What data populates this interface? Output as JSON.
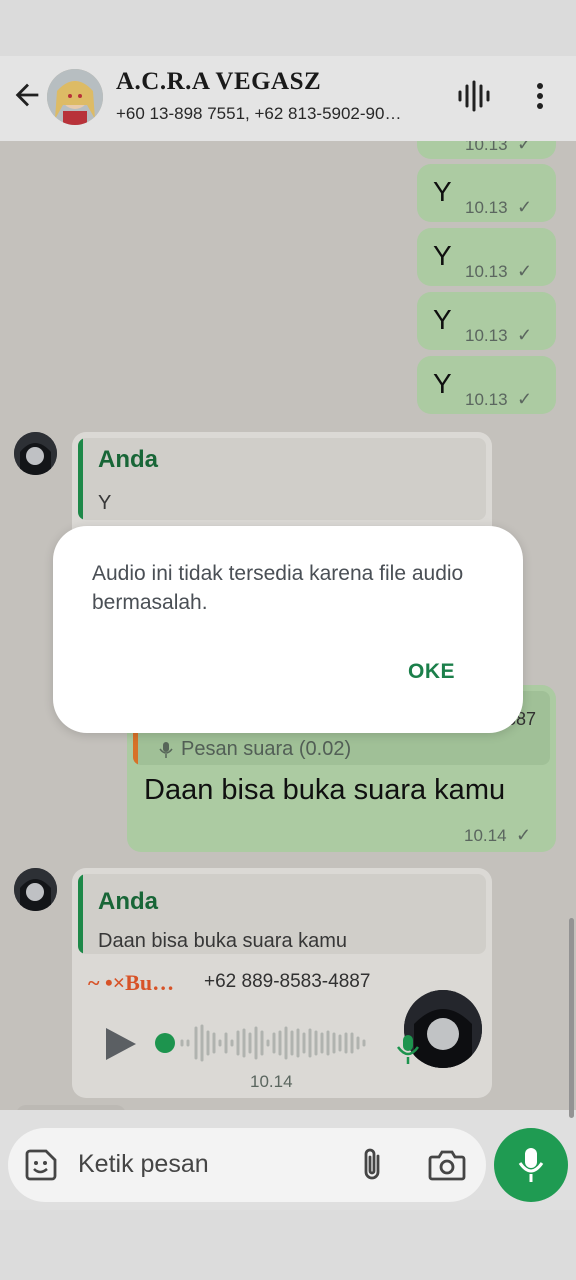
{
  "header": {
    "contact_name": "A.C.R.A VEGASZ",
    "participants": "+60 13-898 7551, +62 813-5902-90…",
    "back_icon": "arrow-left-icon",
    "call_icon": "audio-wave-icon",
    "menu_icon": "more-vertical-icon"
  },
  "messages": {
    "top_partial": {
      "time": "10.13"
    },
    "y1": {
      "text": "Y",
      "time": "10.13"
    },
    "y2": {
      "text": "Y",
      "time": "10.13"
    },
    "y3": {
      "text": "Y",
      "time": "10.13"
    },
    "y4": {
      "text": "Y",
      "time": "10.13"
    },
    "reply_in_1": {
      "quote_name": "Anda",
      "quote_text": "Y"
    },
    "outgoing_reply": {
      "quote_number_fragment": "887",
      "quote_voice": "Pesan suara (0.02)",
      "text": "Daan bisa buka suara kamu",
      "time": "10.14"
    },
    "voice_in": {
      "quote_name": "Anda",
      "quote_text": "Daan bisa buka suara kamu",
      "sender_name": "~ •×Bu…",
      "sender_number": "+62 889-8583-4887",
      "time": "10.14"
    }
  },
  "dialog": {
    "message": "Audio ini tidak tersedia karena file audio bermasalah.",
    "ok_label": "OKE"
  },
  "composer": {
    "placeholder": "Ketik pesan",
    "emoji_icon": "sticker-icon",
    "attach_icon": "paperclip-icon",
    "camera_icon": "camera-icon",
    "mic_icon": "mic-icon"
  },
  "colors": {
    "outgoing_bubble": "#b3d4a9",
    "incoming_bubble": "#e4e2de",
    "accent_green": "#1f9b52",
    "chat_background": "#ccc9c4"
  }
}
